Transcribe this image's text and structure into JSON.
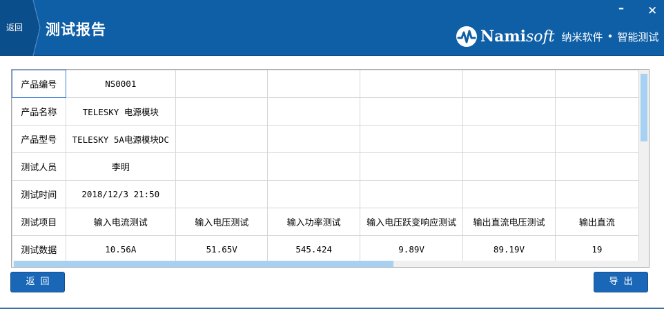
{
  "titlebar": {
    "back_label": "返回",
    "title": "测试报告",
    "minimize_glyph": "–",
    "close_glyph": "✕",
    "brand_name_bold": "Nami",
    "brand_name_italic": "soft",
    "brand_cn": "纳米软件",
    "brand_dot": "•",
    "brand_tagline": "智能测试",
    "colors": {
      "bar": "#0f5fa6",
      "tab": "#0b4e8c"
    }
  },
  "grid": {
    "rows": [
      {
        "label": "产品编号",
        "cells": [
          "NS0001",
          "",
          "",
          "",
          "",
          ""
        ]
      },
      {
        "label": "产品名称",
        "cells": [
          "TELESKY 电源模块",
          "",
          "",
          "",
          "",
          ""
        ]
      },
      {
        "label": "产品型号",
        "cells": [
          "TELESKY 5A电源模块DC",
          "",
          "",
          "",
          "",
          ""
        ]
      },
      {
        "label": "测试人员",
        "cells": [
          "李明",
          "",
          "",
          "",
          "",
          ""
        ]
      },
      {
        "label": "测试时间",
        "cells": [
          "2018/12/3 21:50",
          "",
          "",
          "",
          "",
          ""
        ]
      },
      {
        "label": "测试项目",
        "cells": [
          "输入电流测试",
          "输入电压测试",
          "输入功率测试",
          "输入电压跃变响应测试",
          "输出直流电压测试",
          "输出直流"
        ]
      },
      {
        "label": "测试数据",
        "cells": [
          "10.56A",
          "51.65V",
          "545.424",
          "9.89V",
          "89.19V",
          "19"
        ]
      }
    ]
  },
  "buttons": {
    "back": "返回",
    "export": "导出"
  }
}
